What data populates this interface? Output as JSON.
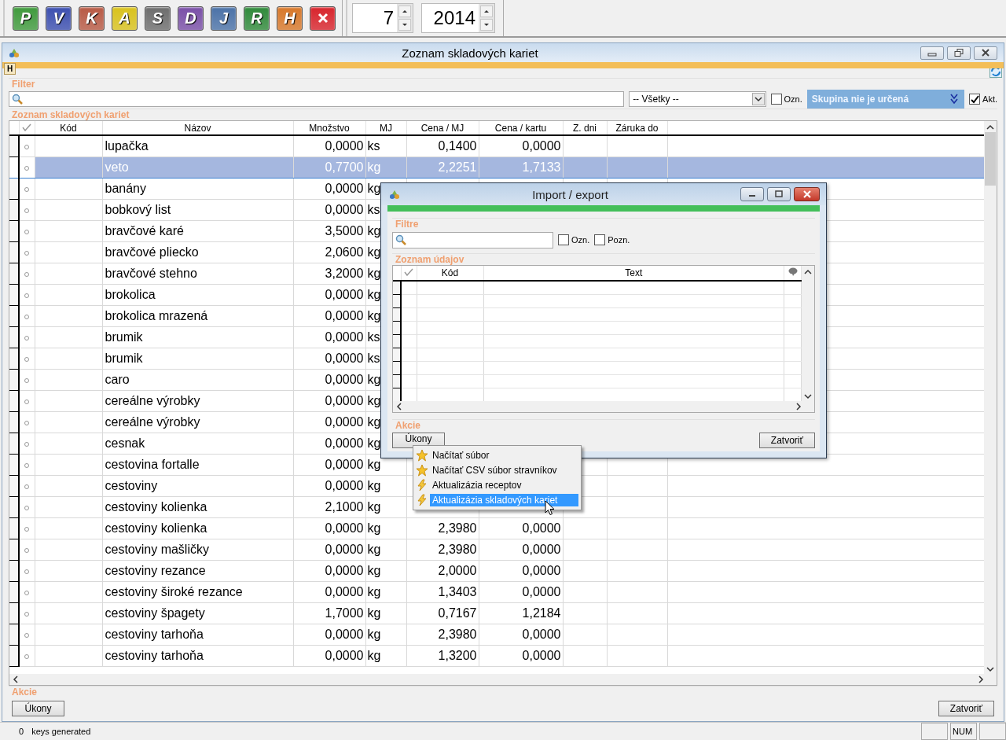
{
  "toolbar": {
    "buttons": [
      {
        "kind": "letter",
        "letter": "P",
        "color": "#3f9a3c"
      },
      {
        "kind": "letter",
        "letter": "V",
        "color": "#3c4fb0"
      },
      {
        "kind": "letter",
        "letter": "K",
        "color": "#b85a45"
      },
      {
        "kind": "letter",
        "letter": "A",
        "color": "#d9c21c"
      },
      {
        "kind": "letter",
        "letter": "S",
        "color": "#6d6d6d"
      },
      {
        "kind": "letter",
        "letter": "D",
        "color": "#7a4fa8"
      },
      {
        "kind": "letter",
        "letter": "J",
        "color": "#4b72a8"
      },
      {
        "kind": "letter",
        "letter": "R",
        "color": "#2f8a3a"
      },
      {
        "kind": "letter",
        "letter": "H",
        "color": "#d8782a"
      },
      {
        "kind": "close",
        "color": "#d8242c"
      }
    ],
    "spinners": [
      {
        "value": "7"
      },
      {
        "value": "2014"
      }
    ]
  },
  "window": {
    "title": "Zoznam skladových kariet",
    "help_button": "H",
    "filter": {
      "label": "Filter",
      "group_select": "-- Všetky --",
      "marked": {
        "label": "Ozn.",
        "checked": false
      },
      "group": "Skupina nie je určená",
      "active": {
        "label": "Akt.",
        "checked": true
      }
    },
    "list": {
      "label": "Zoznam skladových kariet",
      "columns": [
        "Kód",
        "Názov",
        "Množstvo",
        "MJ",
        "Cena / MJ",
        "Cena / kartu",
        "Z. dni",
        "Záruka do"
      ],
      "rows": [
        {
          "name": "lupačka",
          "quantity": "0,0000",
          "unit": "ks",
          "price_unit": "0,1400",
          "price_card": "0,0000",
          "selected": false
        },
        {
          "name": "veto",
          "quantity": "0,7700",
          "unit": "kg",
          "price_unit": "2,2251",
          "price_card": "1,7133",
          "selected": true
        },
        {
          "name": "banány",
          "quantity": "0,0000",
          "unit": "kg",
          "selected": false
        },
        {
          "name": "bobkový list",
          "quantity": "0,0000",
          "unit": "ks",
          "selected": false
        },
        {
          "name": "bravčové karé",
          "quantity": "3,5000",
          "unit": "kg",
          "selected": false
        },
        {
          "name": "bravčové pliecko",
          "quantity": "2,0600",
          "unit": "kg",
          "selected": false
        },
        {
          "name": "bravčové stehno",
          "quantity": "3,2000",
          "unit": "kg",
          "selected": false
        },
        {
          "name": "brokolica",
          "quantity": "0,0000",
          "unit": "kg",
          "selected": false
        },
        {
          "name": "brokolica mrazená",
          "quantity": "0,0000",
          "unit": "kg",
          "selected": false
        },
        {
          "name": "brumik",
          "quantity": "0,0000",
          "unit": "ks",
          "selected": false
        },
        {
          "name": "brumik",
          "quantity": "0,0000",
          "unit": "ks",
          "selected": false
        },
        {
          "name": "caro",
          "quantity": "0,0000",
          "unit": "kg",
          "selected": false
        },
        {
          "name": "cereálne výrobky",
          "quantity": "0,0000",
          "unit": "kg",
          "selected": false
        },
        {
          "name": "cereálne výrobky",
          "quantity": "0,0000",
          "unit": "kg",
          "selected": false
        },
        {
          "name": "cesnak",
          "quantity": "0,0000",
          "unit": "kg",
          "selected": false
        },
        {
          "name": "cestovina fortalle",
          "quantity": "0,0000",
          "unit": "kg",
          "selected": false
        },
        {
          "name": "cestoviny",
          "quantity": "0,0000",
          "unit": "kg",
          "selected": false
        },
        {
          "name": "cestoviny kolienka",
          "quantity": "2,1000",
          "unit": "kg",
          "selected": false
        },
        {
          "name": "cestoviny kolienka",
          "quantity": "0,0000",
          "unit": "kg",
          "price_unit": "2,3980",
          "price_card": "0,0000",
          "selected": false
        },
        {
          "name": "cestoviny mašličky",
          "quantity": "0,0000",
          "unit": "kg",
          "price_unit": "2,3980",
          "price_card": "0,0000",
          "selected": false
        },
        {
          "name": "cestoviny rezance",
          "quantity": "0,0000",
          "unit": "kg",
          "price_unit": "2,0000",
          "price_card": "0,0000",
          "selected": false
        },
        {
          "name": "cestoviny široké rezance",
          "quantity": "0,0000",
          "unit": "kg",
          "price_unit": "1,3403",
          "price_card": "0,0000",
          "selected": false
        },
        {
          "name": "cestoviny špagety",
          "quantity": "1,7000",
          "unit": "kg",
          "price_unit": "0,7167",
          "price_card": "1,2184",
          "selected": false
        },
        {
          "name": "cestoviny tarhoňa",
          "quantity": "0,0000",
          "unit": "kg",
          "price_unit": "2,3980",
          "price_card": "0,0000",
          "selected": false
        },
        {
          "name": "cestoviny tarhoňa",
          "quantity": "0,0000",
          "unit": "kg",
          "price_unit": "1,3200",
          "price_card": "0,0000",
          "selected": false
        }
      ]
    },
    "actions": {
      "label": "Akcie",
      "buttons": [
        "Úkony",
        "Zatvoriť"
      ]
    }
  },
  "dialog": {
    "title": "Import / export",
    "filter": {
      "label": "Filtre",
      "checkboxes": [
        {
          "label": "Ozn.",
          "checked": false
        },
        {
          "label": "Pozn.",
          "checked": false
        }
      ]
    },
    "list": {
      "label": "Zoznam údajov",
      "columns": [
        "Kód",
        "Text"
      ]
    },
    "actions": {
      "label": "Akcie",
      "buttons": [
        "Úkony",
        "Zatvoriť"
      ]
    }
  },
  "menu": {
    "items": [
      {
        "kind": "star",
        "label": "Načítať súbor",
        "selected": false
      },
      {
        "kind": "star",
        "label": "Načítať CSV súbor stravníkov",
        "selected": false
      },
      {
        "kind": "bolt",
        "label": "Aktualizázia receptov",
        "selected": false
      },
      {
        "kind": "bolt",
        "label": "Aktualizázia skladových kariet",
        "selected": true
      }
    ]
  },
  "status_bar": {
    "count": "0",
    "message": "keys generated",
    "indicators": [
      "NUM"
    ]
  }
}
